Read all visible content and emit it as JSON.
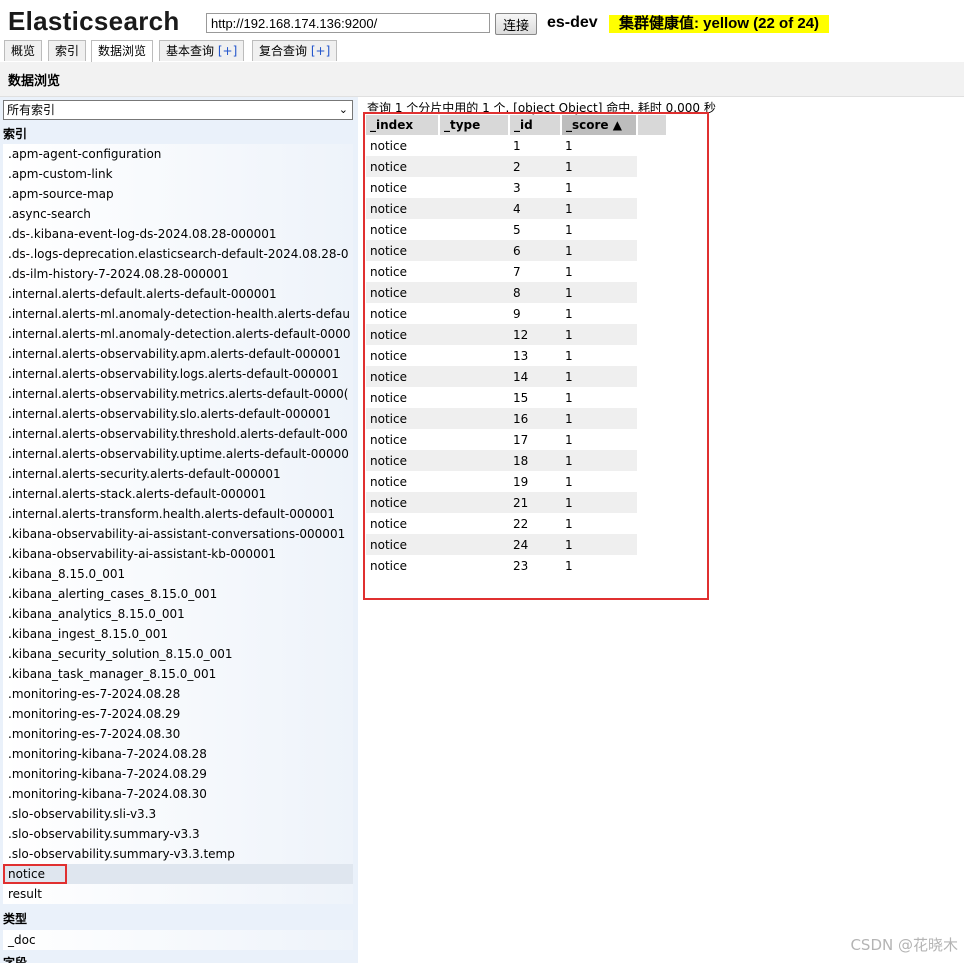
{
  "header": {
    "brand": "Elasticsearch",
    "url": "http://192.168.174.136:9200/",
    "connect_label": "连接",
    "cluster_name": "es-dev",
    "health_text": "集群健康值: yellow (22 of 24)",
    "health_color": "#ffff00"
  },
  "tabs": [
    {
      "label": "概览",
      "plus": ""
    },
    {
      "label": "索引",
      "plus": ""
    },
    {
      "label": "数据浏览",
      "plus": ""
    },
    {
      "label": "基本查询 ",
      "plus": "[+]"
    },
    {
      "label": "复合查询 ",
      "plus": "[+]"
    }
  ],
  "active_tab": "数据浏览",
  "section_title": "数据浏览",
  "sidebar": {
    "index_select": "所有索引",
    "index_group_title": "索引",
    "indices": [
      ".apm-agent-configuration",
      ".apm-custom-link",
      ".apm-source-map",
      ".async-search",
      ".ds-.kibana-event-log-ds-2024.08.28-000001",
      ".ds-.logs-deprecation.elasticsearch-default-2024.08.28-0",
      ".ds-ilm-history-7-2024.08.28-000001",
      ".internal.alerts-default.alerts-default-000001",
      ".internal.alerts-ml.anomaly-detection-health.alerts-defau",
      ".internal.alerts-ml.anomaly-detection.alerts-default-0000",
      ".internal.alerts-observability.apm.alerts-default-000001",
      ".internal.alerts-observability.logs.alerts-default-000001",
      ".internal.alerts-observability.metrics.alerts-default-0000(",
      ".internal.alerts-observability.slo.alerts-default-000001",
      ".internal.alerts-observability.threshold.alerts-default-000",
      ".internal.alerts-observability.uptime.alerts-default-00000",
      ".internal.alerts-security.alerts-default-000001",
      ".internal.alerts-stack.alerts-default-000001",
      ".internal.alerts-transform.health.alerts-default-000001",
      ".kibana-observability-ai-assistant-conversations-000001",
      ".kibana-observability-ai-assistant-kb-000001",
      ".kibana_8.15.0_001",
      ".kibana_alerting_cases_8.15.0_001",
      ".kibana_analytics_8.15.0_001",
      ".kibana_ingest_8.15.0_001",
      ".kibana_security_solution_8.15.0_001",
      ".kibana_task_manager_8.15.0_001",
      ".monitoring-es-7-2024.08.28",
      ".monitoring-es-7-2024.08.29",
      ".monitoring-es-7-2024.08.30",
      ".monitoring-kibana-7-2024.08.28",
      ".monitoring-kibana-7-2024.08.29",
      ".monitoring-kibana-7-2024.08.30",
      ".slo-observability.sli-v3.3",
      ".slo-observability.summary-v3.3",
      ".slo-observability.summary-v3.3.temp",
      "notice",
      "result"
    ],
    "selected_index": "notice",
    "type_group_title": "类型",
    "types": [
      "_doc"
    ],
    "field_group_title": "字段"
  },
  "results": {
    "query_info": "查询 1 个分片中用的 1 个. [object Object] 命中. 耗时 0.000 秒",
    "columns": [
      "_index",
      "_type",
      "_id",
      "_score ▲"
    ],
    "rows": [
      [
        "notice",
        "",
        "1",
        "1"
      ],
      [
        "notice",
        "",
        "2",
        "1"
      ],
      [
        "notice",
        "",
        "3",
        "1"
      ],
      [
        "notice",
        "",
        "4",
        "1"
      ],
      [
        "notice",
        "",
        "5",
        "1"
      ],
      [
        "notice",
        "",
        "6",
        "1"
      ],
      [
        "notice",
        "",
        "7",
        "1"
      ],
      [
        "notice",
        "",
        "8",
        "1"
      ],
      [
        "notice",
        "",
        "9",
        "1"
      ],
      [
        "notice",
        "",
        "12",
        "1"
      ],
      [
        "notice",
        "",
        "13",
        "1"
      ],
      [
        "notice",
        "",
        "14",
        "1"
      ],
      [
        "notice",
        "",
        "15",
        "1"
      ],
      [
        "notice",
        "",
        "16",
        "1"
      ],
      [
        "notice",
        "",
        "17",
        "1"
      ],
      [
        "notice",
        "",
        "18",
        "1"
      ],
      [
        "notice",
        "",
        "19",
        "1"
      ],
      [
        "notice",
        "",
        "21",
        "1"
      ],
      [
        "notice",
        "",
        "22",
        "1"
      ],
      [
        "notice",
        "",
        "24",
        "1"
      ],
      [
        "notice",
        "",
        "23",
        "1"
      ]
    ]
  },
  "watermark": "CSDN @花晓木"
}
